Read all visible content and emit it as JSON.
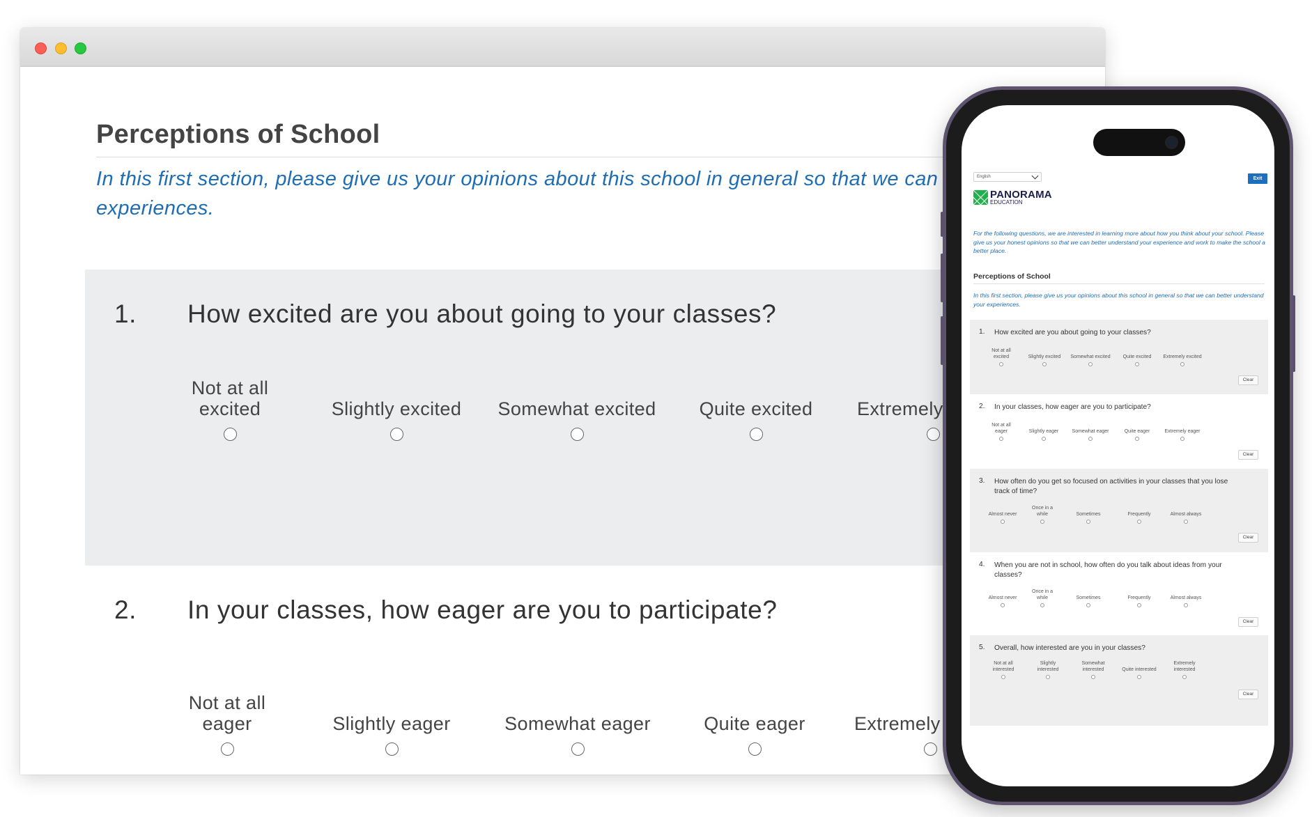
{
  "browser": {
    "window_controls": [
      "close",
      "minimize",
      "maximize"
    ],
    "page_title": "Perceptions of School",
    "intro": "In this first section, please give us your opinions about this school in general so that we can better understand your experiences.",
    "questions": [
      {
        "number": "1.",
        "text": "How excited are you about going to your classes?",
        "options": [
          "Not at all\nexcited",
          "Slightly excited",
          "Somewhat excited",
          "Quite excited",
          "Extremely excited"
        ]
      },
      {
        "number": "2.",
        "text": "In your classes, how eager are you to participate?",
        "options": [
          "Not at all\neager",
          "Slightly eager",
          "Somewhat eager",
          "Quite eager",
          "Extremely eager"
        ]
      }
    ]
  },
  "phone": {
    "language_select": {
      "value": "English"
    },
    "exit_label": "Exit",
    "logo": {
      "name": "PANORAMA",
      "sub": "EDUCATION",
      "color": "#21b14b"
    },
    "intro": "For the following questions, we are interested in learning more about how you think about your school. Please give us your honest opinions so that we can better understand your experience and work to make the school a better place.",
    "section_title": "Perceptions of School",
    "section_intro": "In this first section, please give us your opinions about this school in general so that we can better understand your experiences.",
    "clear_label": "Clear",
    "questions": [
      {
        "number": "1.",
        "text": "How excited are you about going to your classes?",
        "options": [
          "Not at all\nexcited",
          "Slightly excited",
          "Somewhat excited",
          "Quite excited",
          "Extremely excited"
        ]
      },
      {
        "number": "2.",
        "text": "In your classes, how eager are you to participate?",
        "options": [
          "Not at all\neager",
          "Slightly eager",
          "Somewhat eager",
          "Quite eager",
          "Extremely eager"
        ]
      },
      {
        "number": "3.",
        "text": "How often do you get so focused on activities in your classes that you lose track of time?",
        "options": [
          "Almost never",
          "Once in a\nwhile",
          "Sometimes",
          "Frequently",
          "Almost always"
        ]
      },
      {
        "number": "4.",
        "text": "When you are not in school, how often do you talk about ideas from your classes?",
        "options": [
          "Almost never",
          "Once in a\nwhile",
          "Sometimes",
          "Frequently",
          "Almost always"
        ]
      },
      {
        "number": "5.",
        "text": "Overall, how interested are you in your classes?",
        "options": [
          "Not at all\ninterested",
          "Slightly\ninterested",
          "Somewhat\ninterested",
          "Quite interested",
          "Extremely\ninterested"
        ]
      }
    ]
  },
  "colors": {
    "accent_blue": "#1f6db3",
    "exit_button": "#1e6fc0",
    "panel_shade": "#ebedef"
  }
}
